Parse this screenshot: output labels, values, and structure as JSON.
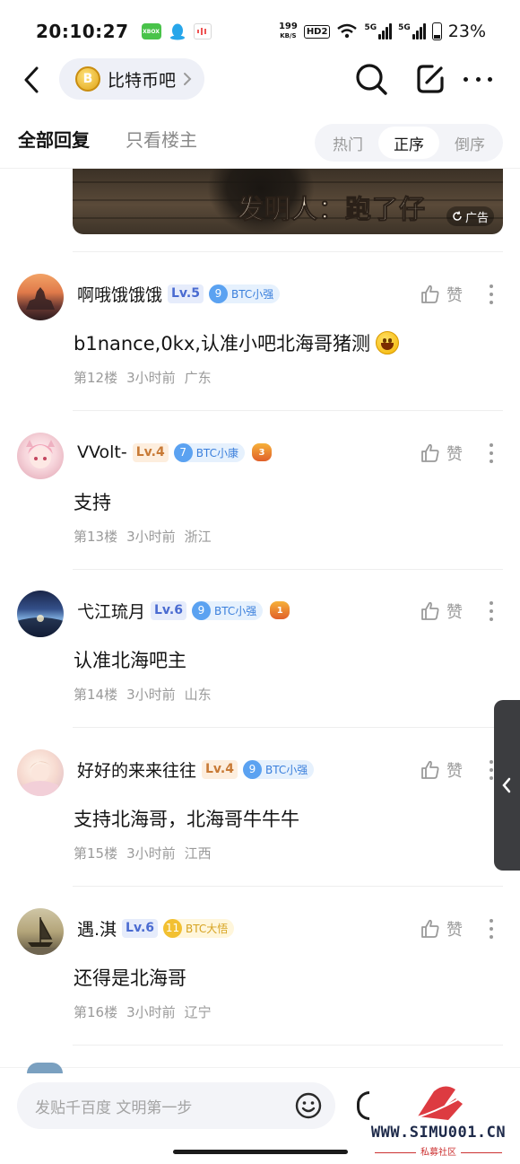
{
  "status_bar": {
    "time": "20:10:27",
    "app1": "XBOX",
    "speed_top": "199",
    "speed_bottom": "KB/S",
    "hd": "HD2",
    "signal1": "5G",
    "signal2": "5G",
    "battery": "23%"
  },
  "header": {
    "forum_name": "比特币吧",
    "forum_avatar_glyph": "B"
  },
  "tabs": {
    "all": "全部回复",
    "owner": "只看楼主",
    "sort": [
      "热门",
      "正序",
      "倒序"
    ],
    "sort_active": "正序"
  },
  "ad": {
    "text": "发明人：跑了仔",
    "badge": "广告"
  },
  "comments": [
    {
      "name": "啊哦饿饿饿",
      "level": "Lv.5",
      "title_num": "9",
      "title": "BTC小强",
      "title_style": "blue",
      "body": "b1nance,0kx,认准小吧北海哥猪测",
      "floor": "第12楼",
      "time": "3小时前",
      "location": "广东",
      "like": "赞"
    },
    {
      "name": "VVolt-",
      "level": "Lv.4",
      "title_num": "7",
      "title": "BTC小康",
      "title_style": "blue",
      "emo": "3",
      "body": "支持",
      "floor": "第13楼",
      "time": "3小时前",
      "location": "浙江",
      "like": "赞"
    },
    {
      "name": "弋江琉月",
      "level": "Lv.6",
      "title_num": "9",
      "title": "BTC小强",
      "title_style": "blue",
      "emo": "1",
      "body": "认准北海吧主",
      "floor": "第14楼",
      "time": "3小时前",
      "location": "山东",
      "like": "赞"
    },
    {
      "name": "好好的来来往往",
      "level": "Lv.4",
      "title_num": "9",
      "title": "BTC小强",
      "title_style": "blue",
      "body": "支持北海哥，北海哥牛牛牛",
      "floor": "第15楼",
      "time": "3小时前",
      "location": "江西",
      "like": "赞"
    },
    {
      "name": "遇.淇",
      "level": "Lv.6",
      "title_num": "11",
      "title": "BTC大悟",
      "title_style": "gold",
      "body": "还得是北海哥",
      "floor": "第16楼",
      "time": "3小时前",
      "location": "辽宁",
      "like": "赞"
    }
  ],
  "reply_bar": {
    "placeholder": "发贴千百度 文明第一步"
  },
  "watermark": {
    "url": "WWW.SIMU001.CN",
    "sub": "私募社区"
  },
  "icons": [
    "back-icon",
    "chevron-right-icon",
    "search-icon",
    "edit-icon",
    "more-icon",
    "thumbs-up-icon",
    "emoji-icon",
    "refresh-icon",
    "chevron-left-icon"
  ]
}
